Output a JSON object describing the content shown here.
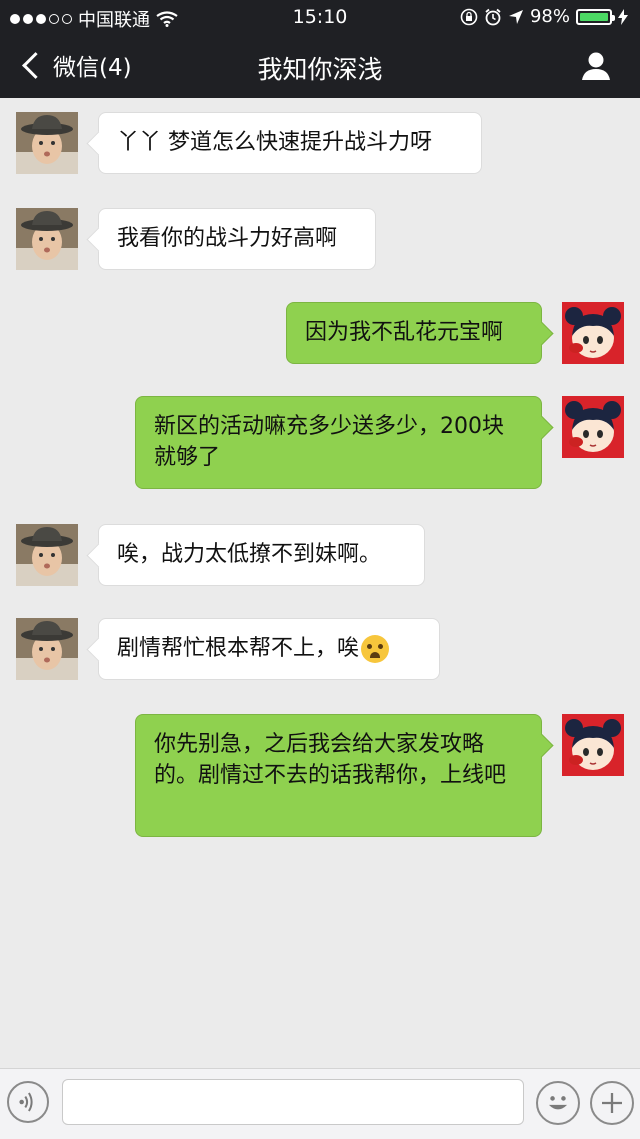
{
  "status_bar": {
    "carrier": "中国联通",
    "time": "15:10",
    "battery": "98%",
    "battery_level": 0.98
  },
  "nav": {
    "back_label": "微信(4)",
    "title": "我知你深浅"
  },
  "messages": [
    {
      "side": "in",
      "text": "丫丫 梦道怎么快速提升战斗力呀"
    },
    {
      "side": "in",
      "text": "我看你的战斗力好高啊"
    },
    {
      "side": "out",
      "text": "因为我不乱花元宝啊"
    },
    {
      "side": "out",
      "text": "新区的活动嘛充多少送多少，200块就够了"
    },
    {
      "side": "in",
      "text": "唉，战力太低撩不到妹啊。"
    },
    {
      "side": "in",
      "text": "剧情帮忙根本帮不上，唉",
      "emoji": "crying-face"
    },
    {
      "side": "out",
      "text": "你先别急，之后我会给大家发攻略的。剧情过不去的话我帮你，上线吧"
    }
  ],
  "colors": {
    "header": "#1f2024",
    "chat_bg": "#ebebeb",
    "outgoing_bubble": "#8fd14f",
    "incoming_bubble": "#ffffff"
  },
  "icons": [
    "back-chevron-icon",
    "profile-icon",
    "voice-icon",
    "emoji-icon",
    "plus-icon",
    "wifi-icon",
    "alarm-icon",
    "location-icon",
    "lock-rotation-icon",
    "charging-icon"
  ]
}
